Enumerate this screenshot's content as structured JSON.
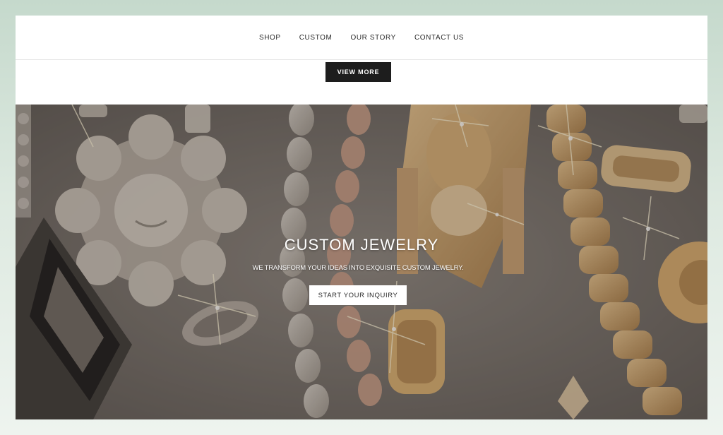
{
  "nav": {
    "items": [
      {
        "label": "SHOP"
      },
      {
        "label": "CUSTOM"
      },
      {
        "label": "OUR STORY"
      },
      {
        "label": "CONTACT US"
      }
    ]
  },
  "view_more_label": "VIEW MORE",
  "hero": {
    "title": "CUSTOM JEWELRY",
    "subtitle": "WE TRANSFORM YOUR IDEAS INTO EXQUISITE CUSTOM JEWELRY.",
    "cta_label": "START YOUR INQUIRY"
  },
  "colors": {
    "page_background": "#dde9e0",
    "nav_text": "#2a2a2a",
    "dark_button": "#1d1d1d",
    "hero_overlay": "#77706a",
    "gold": "#c9995e"
  }
}
